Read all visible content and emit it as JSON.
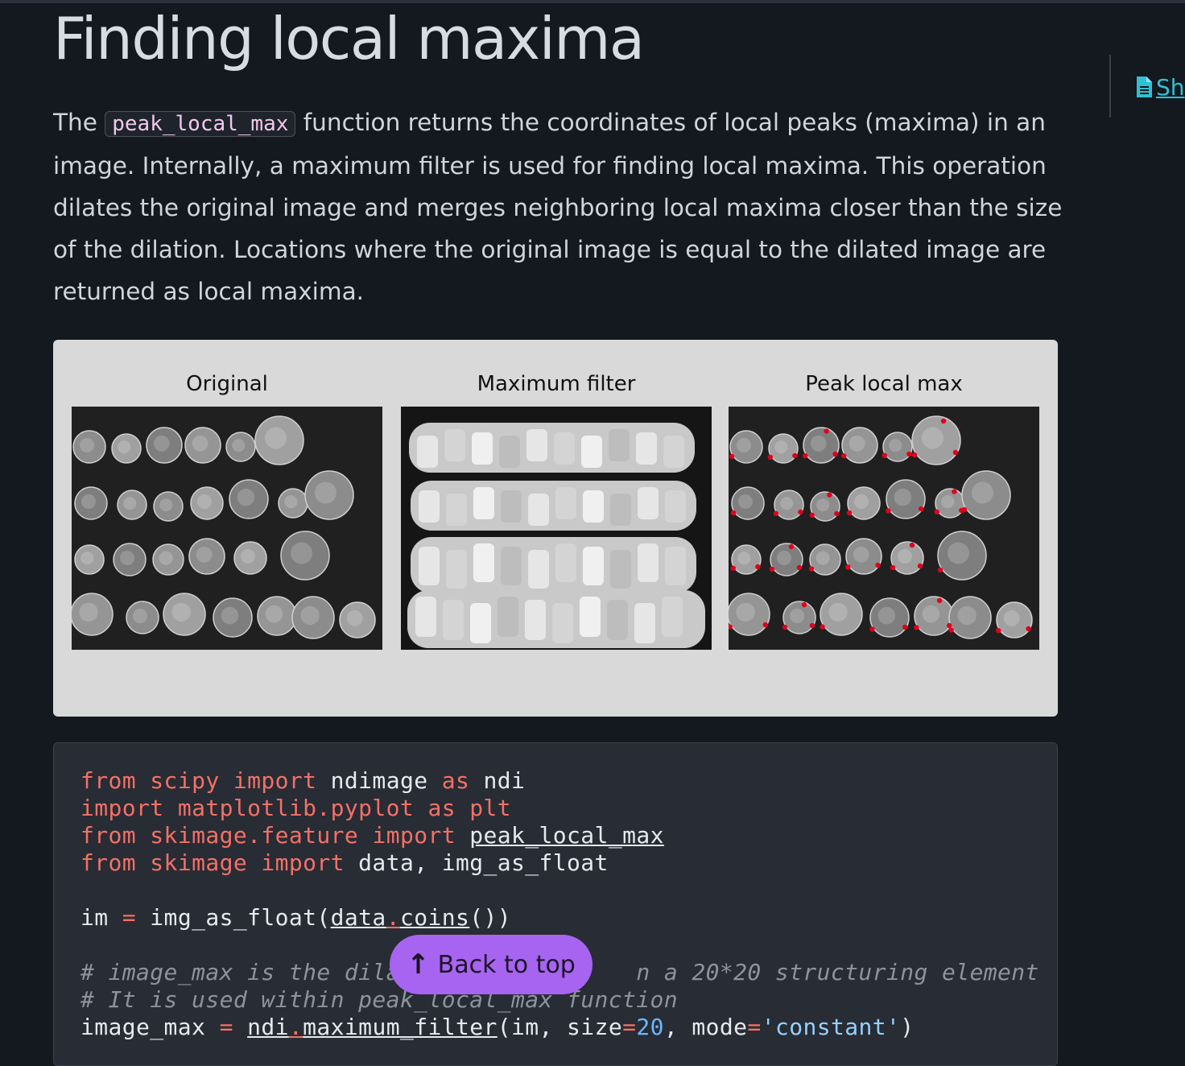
{
  "page": {
    "title": "Finding local maxima",
    "source_link": "Sh"
  },
  "intro": {
    "before": "The ",
    "code": "peak_local_max",
    "after": " function returns the coordinates of local peaks (maxima) in an image. Internally, a maximum filter is used for finding local maxima. This operation dilates the original image and merges neighboring local maxima closer than the size of the dilation. Locations where the original image is equal to the dilated image are returned as local maxima."
  },
  "figure": {
    "panels": [
      {
        "title": "Original"
      },
      {
        "title": "Maximum filter"
      },
      {
        "title": "Peak local max"
      }
    ]
  },
  "code": {
    "lines": [
      [
        {
          "t": "from",
          "c": "kw"
        },
        {
          "t": " "
        },
        {
          "t": "scipy",
          "c": "kw"
        },
        {
          "t": " "
        },
        {
          "t": "import",
          "c": "kw"
        },
        {
          "t": " ndimage "
        },
        {
          "t": "as",
          "c": "kw"
        },
        {
          "t": " ndi"
        }
      ],
      [
        {
          "t": "import",
          "c": "kw"
        },
        {
          "t": " "
        },
        {
          "t": "matplotlib.pyplot",
          "c": "kw"
        },
        {
          "t": " "
        },
        {
          "t": "as",
          "c": "kw"
        },
        {
          "t": " "
        },
        {
          "t": "plt",
          "c": "kw"
        }
      ],
      [
        {
          "t": "from",
          "c": "kw"
        },
        {
          "t": " "
        },
        {
          "t": "skimage.feature",
          "c": "kw"
        },
        {
          "t": " "
        },
        {
          "t": "import",
          "c": "kw"
        },
        {
          "t": " "
        },
        {
          "t": "peak_local_max",
          "c": "ul"
        }
      ],
      [
        {
          "t": "from",
          "c": "kw"
        },
        {
          "t": " "
        },
        {
          "t": "skimage",
          "c": "kw"
        },
        {
          "t": " "
        },
        {
          "t": "import",
          "c": "kw"
        },
        {
          "t": " data, img_as_float"
        }
      ],
      [],
      [
        {
          "t": "im "
        },
        {
          "t": "=",
          "c": "kw"
        },
        {
          "t": " img_as_float("
        },
        {
          "t": "data",
          "c": "ul"
        },
        {
          "t": ".",
          "c": "kw ul"
        },
        {
          "t": "coins",
          "c": "ul"
        },
        {
          "t": "())"
        }
      ],
      [],
      [
        {
          "t": "# image_max is the dila",
          "c": "cm"
        },
        {
          "t": "                 ",
          "c": "cm"
        },
        {
          "t": "n a 20*20 structuring element",
          "c": "cm"
        }
      ],
      [
        {
          "t": "# It is used within peak_local_max function",
          "c": "cm"
        }
      ],
      [
        {
          "t": "image_max "
        },
        {
          "t": "=",
          "c": "kw"
        },
        {
          "t": " "
        },
        {
          "t": "ndi",
          "c": "ul"
        },
        {
          "t": ".",
          "c": "kw ul"
        },
        {
          "t": "maximum_filter",
          "c": "ul"
        },
        {
          "t": "(im, size"
        },
        {
          "t": "=",
          "c": "kw"
        },
        {
          "t": "20",
          "c": "num"
        },
        {
          "t": ", mode"
        },
        {
          "t": "=",
          "c": "kw"
        },
        {
          "t": "'constant'",
          "c": "str"
        },
        {
          "t": ")"
        }
      ]
    ]
  },
  "back_to_top": {
    "label": "Back to top",
    "icon": "arrow-up-icon"
  },
  "colors": {
    "background": "#14181f",
    "code_background": "#282c34",
    "keyword": "#f47067",
    "accent": "#a764f0",
    "link": "#2fc0d3",
    "peak_marker": "#e0001b"
  }
}
